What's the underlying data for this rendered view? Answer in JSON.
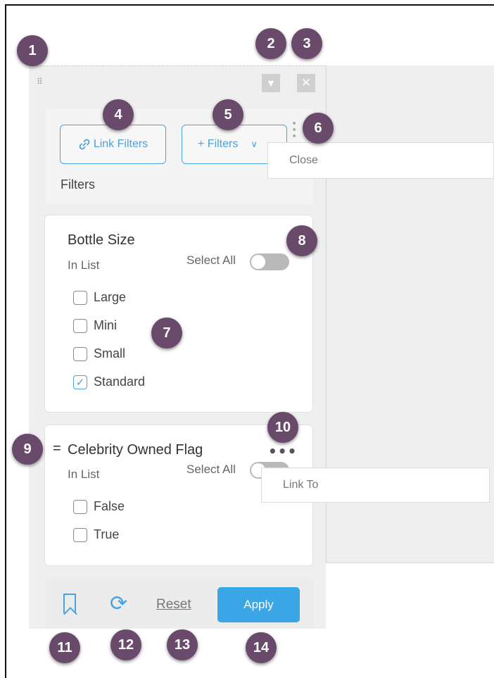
{
  "toolbar": {
    "drag_icon": "grip-dots-icon",
    "dropdown_icon": "caret-down-icon",
    "close_icon": "close-x-icon"
  },
  "header": {
    "link_filters_icon": "link-icon",
    "link_filters_label": "Link Filters",
    "add_filters_label": "+ Filters",
    "add_filters_chevron": "chevron-down-icon",
    "more_icon": "vertical-dots-icon",
    "close_menu_label": "Close",
    "title": "Filters"
  },
  "filters": [
    {
      "title": "Bottle Size",
      "operator": "In List",
      "select_all_label": "Select All",
      "select_all_on": false,
      "options": [
        {
          "label": "Large",
          "checked": false
        },
        {
          "label": "Mini",
          "checked": false
        },
        {
          "label": "Small",
          "checked": false
        },
        {
          "label": "Standard",
          "checked": true
        }
      ]
    },
    {
      "drag_glyph": "=",
      "title": "Celebrity Owned Flag",
      "operator": "In List",
      "select_all_label": "Select All",
      "select_all_on": false,
      "more_icon": "horizontal-dots-icon",
      "menu_label": "Link To",
      "options": [
        {
          "label": "False",
          "checked": false
        },
        {
          "label": "True",
          "checked": false
        }
      ]
    }
  ],
  "footer": {
    "bookmark_icon": "bookmark-icon",
    "refresh_icon": "refresh-icon",
    "reset_label": "Reset",
    "apply_label": "Apply"
  },
  "callouts": [
    "1",
    "2",
    "3",
    "4",
    "5",
    "6",
    "7",
    "8",
    "9",
    "10",
    "11",
    "12",
    "13",
    "14"
  ],
  "colors": {
    "accent": "#4aa3df",
    "apply_button": "#3aa6e6",
    "callout_badge": "#6a4a6b",
    "panel_bg": "#efefef"
  }
}
